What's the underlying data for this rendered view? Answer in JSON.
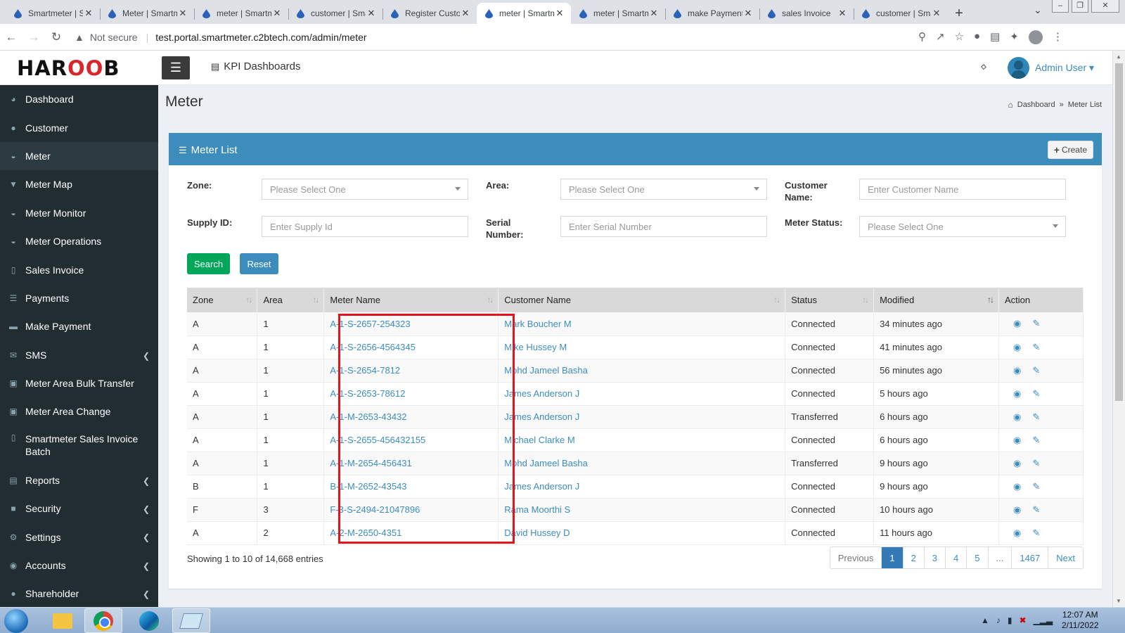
{
  "browser": {
    "tabs": [
      {
        "title": "Smartmeter | Smart",
        "active": false
      },
      {
        "title": "Meter | Smartmeter",
        "active": false
      },
      {
        "title": "meter | Smartmeter",
        "active": false
      },
      {
        "title": "customer | Smartmeter",
        "active": false
      },
      {
        "title": "Register Customer",
        "active": false
      },
      {
        "title": "meter | Smartmeter",
        "active": true
      },
      {
        "title": "meter | Smartmeter",
        "active": false
      },
      {
        "title": "make Payment",
        "active": false
      },
      {
        "title": "sales Invoice",
        "active": false
      },
      {
        "title": "customer | Smartmeter",
        "active": false
      }
    ],
    "not_secure": "Not secure",
    "url": "test.portal.smartmeter.c2btech.com/admin/meter"
  },
  "header": {
    "logo_text": "HAROOB",
    "kpi_label": "KPI Dashboards",
    "user_name": "Admin User"
  },
  "sidebar": {
    "items": [
      {
        "label": "Dashboard",
        "icon": "dashboard-icon"
      },
      {
        "label": "Customer",
        "icon": "user-icon"
      },
      {
        "label": "Meter",
        "icon": "gauge-icon",
        "active": true
      },
      {
        "label": "Meter Map",
        "icon": "map-marker-icon"
      },
      {
        "label": "Meter Monitor",
        "icon": "monitor-icon"
      },
      {
        "label": "Meter Operations",
        "icon": "operations-icon"
      },
      {
        "label": "Sales Invoice",
        "icon": "file-icon"
      },
      {
        "label": "Payments",
        "icon": "list-icon"
      },
      {
        "label": "Make Payment",
        "icon": "credit-card-icon"
      },
      {
        "label": "SMS",
        "icon": "sms-icon",
        "expandable": true
      },
      {
        "label": "Meter Area Bulk Transfer",
        "icon": "transfer-icon"
      },
      {
        "label": "Meter Area Change",
        "icon": "edit-icon"
      },
      {
        "label": "Smartmeter Sales Invoice Batch",
        "icon": "file-icon"
      },
      {
        "label": "Reports",
        "icon": "report-icon",
        "expandable": true
      },
      {
        "label": "Security",
        "icon": "lock-icon",
        "expandable": true
      },
      {
        "label": "Settings",
        "icon": "gear-icon",
        "expandable": true
      },
      {
        "label": "Accounts",
        "icon": "accounts-icon",
        "expandable": true
      },
      {
        "label": "Shareholder",
        "icon": "user-icon",
        "expandable": true
      }
    ]
  },
  "page": {
    "title": "Meter",
    "breadcrumb": [
      "Dashboard",
      "Meter List"
    ],
    "panel_title": "Meter List",
    "create_label": "Create"
  },
  "filters": {
    "zone_label": "Zone:",
    "zone_value": "Please Select One",
    "area_label": "Area:",
    "area_value": "Please Select One",
    "customer_label": "Customer Name:",
    "customer_placeholder": "Enter Customer Name",
    "supply_label": "Supply ID:",
    "supply_placeholder": "Enter Supply Id",
    "serial_label": "Serial Number:",
    "serial_placeholder": "Enter Serial Number",
    "status_label": "Meter Status:",
    "status_value": "Please Select One",
    "search_label": "Search",
    "reset_label": "Reset"
  },
  "table": {
    "columns": [
      "Zone",
      "Area",
      "Meter Name",
      "Customer Name",
      "Status",
      "Modified",
      "Action"
    ],
    "rows": [
      {
        "zone": "A",
        "area": "1",
        "meter": "A-1-S-2657-254323",
        "customer": "Mark Boucher M",
        "status": "Connected",
        "modified": "34 minutes ago"
      },
      {
        "zone": "A",
        "area": "1",
        "meter": "A-1-S-2656-4564345",
        "customer": "Mike Hussey M",
        "status": "Connected",
        "modified": "41 minutes ago"
      },
      {
        "zone": "A",
        "area": "1",
        "meter": "A-1-S-2654-7812",
        "customer": "Mohd Jameel Basha",
        "status": "Connected",
        "modified": "56 minutes ago"
      },
      {
        "zone": "A",
        "area": "1",
        "meter": "A-1-S-2653-78612",
        "customer": "James Anderson J",
        "status": "Connected",
        "modified": "5 hours ago"
      },
      {
        "zone": "A",
        "area": "1",
        "meter": "A-1-M-2653-43432",
        "customer": "James Anderson J",
        "status": "Transferred",
        "modified": "6 hours ago"
      },
      {
        "zone": "A",
        "area": "1",
        "meter": "A-1-S-2655-456432155",
        "customer": "Michael Clarke M",
        "status": "Connected",
        "modified": "6 hours ago"
      },
      {
        "zone": "A",
        "area": "1",
        "meter": "A-1-M-2654-456431",
        "customer": "Mohd Jameel Basha",
        "status": "Transferred",
        "modified": "9 hours ago"
      },
      {
        "zone": "B",
        "area": "1",
        "meter": "B-1-M-2652-43543",
        "customer": "James Anderson J",
        "status": "Connected",
        "modified": "9 hours ago"
      },
      {
        "zone": "F",
        "area": "3",
        "meter": "F-3-S-2494-21047896",
        "customer": "Rama Moorthi S",
        "status": "Connected",
        "modified": "10 hours ago"
      },
      {
        "zone": "A",
        "area": "2",
        "meter": "A-2-M-2650-4351",
        "customer": "David Hussey D",
        "status": "Connected",
        "modified": "11 hours ago"
      }
    ],
    "info": "Showing 1 to 10 of 14,668 entries"
  },
  "pagination": {
    "pages": [
      "Previous",
      "1",
      "2",
      "3",
      "4",
      "5",
      "...",
      "1467",
      "Next"
    ],
    "current": "1"
  },
  "taskbar": {
    "time": "12:07 AM",
    "date": "2/11/2022"
  },
  "colors": {
    "accent": "#3c8dbc",
    "sidebar": "#222d32",
    "success": "#00a65a",
    "highlight": "#e3141c"
  }
}
